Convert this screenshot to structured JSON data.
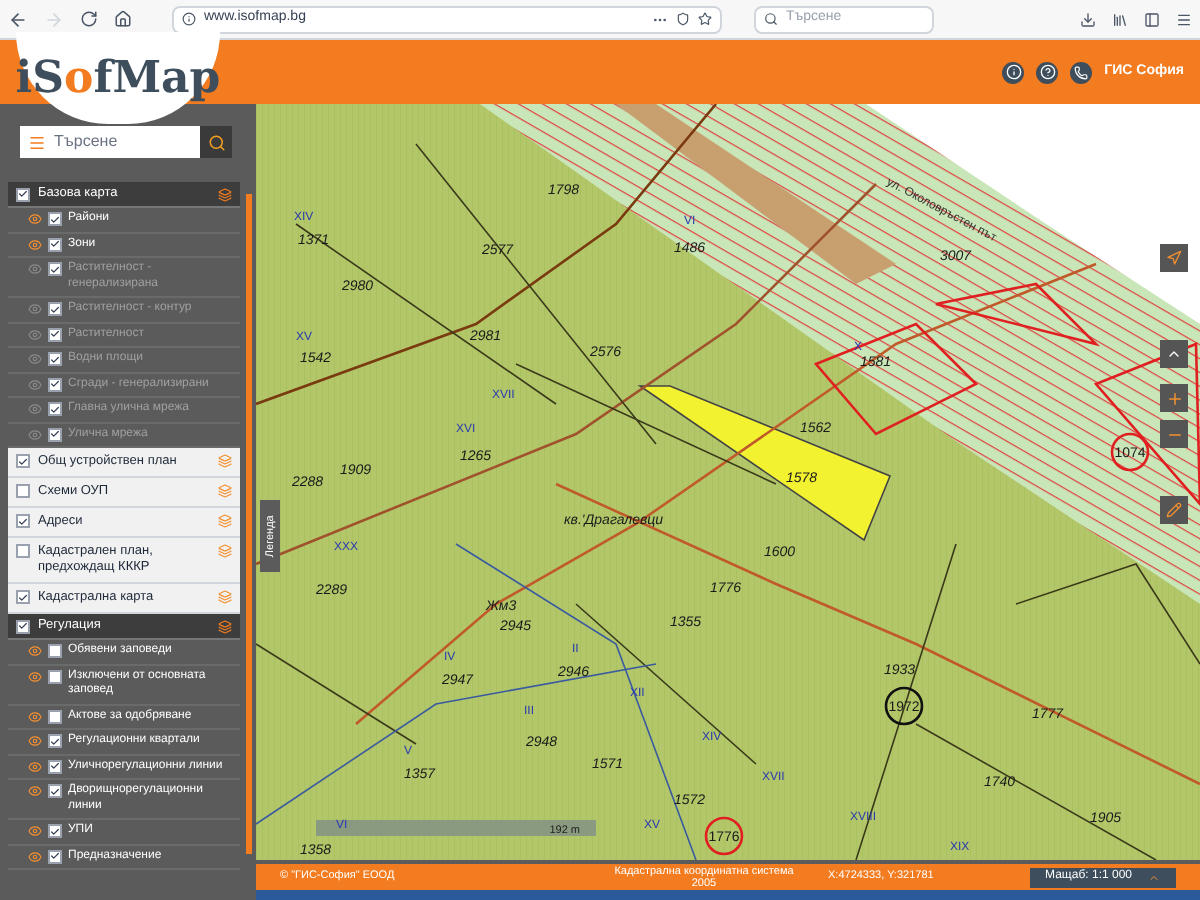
{
  "browser": {
    "url": "www.isofmap.bg",
    "search_placeholder": "Търсене"
  },
  "header": {
    "logo_prefix": "iS",
    "logo_mid": "o",
    "logo_suffix": "fMap",
    "partner_logo": "ГИС София"
  },
  "search": {
    "placeholder": "Търсене"
  },
  "layers": [
    {
      "label": "Базова карта",
      "kind": "group",
      "checked": true,
      "children": [
        {
          "label": "Райони",
          "checked": true,
          "visible": true
        },
        {
          "label": "Зони",
          "checked": true,
          "visible": true
        },
        {
          "label": "Растителност - генерализирана",
          "checked": true,
          "visible": false
        },
        {
          "label": "Растителност - контур",
          "checked": true,
          "visible": false
        },
        {
          "label": "Растителност",
          "checked": true,
          "visible": false
        },
        {
          "label": "Водни площи",
          "checked": true,
          "visible": false
        },
        {
          "label": "Сгради - генерализирани",
          "checked": true,
          "visible": false
        },
        {
          "label": "Главна улична мрежа",
          "checked": true,
          "visible": false
        },
        {
          "label": "Улична мрежа",
          "checked": true,
          "visible": false
        }
      ]
    },
    {
      "label": "Общ устройствен план",
      "kind": "layer",
      "checked": true
    },
    {
      "label": "Схеми ОУП",
      "kind": "layer",
      "checked": false
    },
    {
      "label": "Адреси",
      "kind": "layer",
      "checked": true
    },
    {
      "label": "Кадастрален план, предхождащ КККР",
      "kind": "layer",
      "checked": false
    },
    {
      "label": "Кадастрална карта",
      "kind": "layer",
      "checked": true
    },
    {
      "label": "Регулация",
      "kind": "group",
      "checked": true,
      "children": [
        {
          "label": "Обявени заповеди",
          "checked": false,
          "visible": true
        },
        {
          "label": "Изключени от основната заповед",
          "checked": false,
          "visible": true
        },
        {
          "label": "Актове за одобряване",
          "checked": false,
          "visible": true
        },
        {
          "label": "Регулационни квартали",
          "checked": true,
          "visible": true
        },
        {
          "label": "Уличнорегулационни линии",
          "checked": true,
          "visible": true
        },
        {
          "label": "Дворищнорегулационни линии",
          "checked": true,
          "visible": true
        },
        {
          "label": "УПИ",
          "checked": true,
          "visible": true
        },
        {
          "label": "Предназначение",
          "checked": true,
          "visible": true
        }
      ]
    }
  ],
  "legend_tab": "Легенда",
  "map": {
    "street": "ул. Околовръстен път",
    "scale_bar": "192 m",
    "labels": [
      "1798",
      "XIV",
      "VI",
      "1371",
      "1486",
      "2577",
      "3007",
      "2980",
      "XV",
      "2981",
      "X",
      "2576",
      "1542",
      "1581",
      "XVII",
      "XVI",
      "1562",
      "1265",
      "1909",
      "1578",
      "2288",
      "кв.'Драгалевци",
      "XXX",
      "1600",
      "1776",
      "2289",
      "Жм3",
      "1355",
      "2945",
      "II",
      "IV",
      "1933",
      "2946",
      "2947",
      "XII",
      "III",
      "1777",
      "XIV",
      "2948",
      "V",
      "1571",
      "1357",
      "XVII",
      "1740",
      "1572",
      "XVIII",
      "1905",
      "VI",
      "XV",
      "XIX",
      "1358"
    ],
    "circled": [
      {
        "label": "1074",
        "color": "#e02020"
      },
      {
        "label": "1972",
        "color": "#111111"
      },
      {
        "label": "1776",
        "color": "#e02020"
      }
    ]
  },
  "footer": {
    "copyright": "© \"ГИС-София\" ЕООД",
    "crs": "Кадастрална координатна система 2005",
    "coords": "X:4724333, Y:321781",
    "scale": "Мащаб: 1:1 000"
  }
}
